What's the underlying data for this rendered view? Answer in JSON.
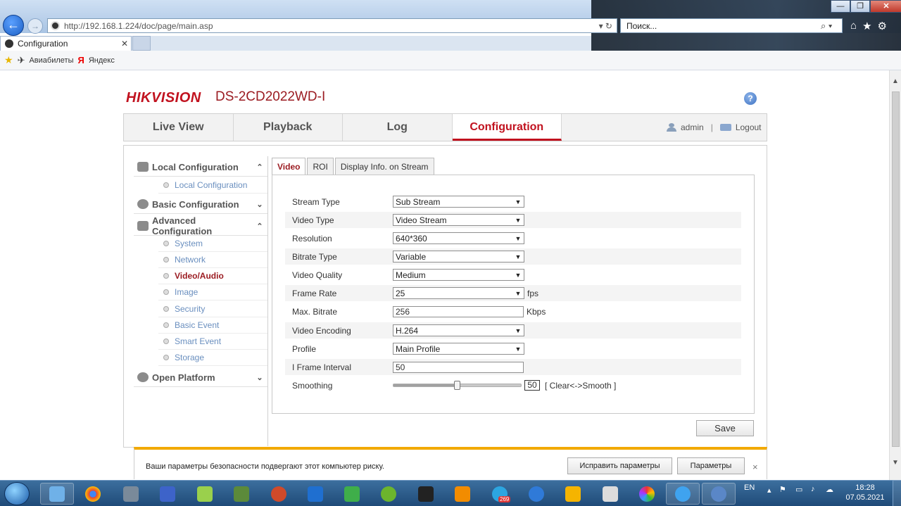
{
  "browser": {
    "url": "http://192.168.1.224/doc/page/main.asp",
    "search_placeholder": "Поиск...",
    "tab_title": "Configuration",
    "favorites": [
      "Авиабилеты",
      "Яндекс"
    ]
  },
  "header": {
    "brand": "HIKVISION",
    "model": "DS-2CD2022WD-I",
    "help": "?"
  },
  "nav": {
    "items": [
      "Live View",
      "Playback",
      "Log",
      "Configuration"
    ],
    "active": "Configuration",
    "user": "admin",
    "separator": "|",
    "logout": "Logout"
  },
  "sidebar": {
    "local_configuration": "Local Configuration",
    "local_items": [
      "Local Configuration"
    ],
    "basic_configuration": "Basic Configuration",
    "advanced_configuration": "Advanced Configuration",
    "advanced_items": [
      "System",
      "Network",
      "Video/Audio",
      "Image",
      "Security",
      "Basic Event",
      "Smart Event",
      "Storage"
    ],
    "active_item": "Video/Audio",
    "open_platform": "Open Platform"
  },
  "tabs": {
    "items": [
      "Video",
      "ROI",
      "Display Info. on Stream"
    ],
    "active": "Video"
  },
  "form": {
    "stream_type": {
      "label": "Stream Type",
      "value": "Sub Stream"
    },
    "video_type": {
      "label": "Video Type",
      "value": "Video Stream"
    },
    "resolution": {
      "label": "Resolution",
      "value": "640*360"
    },
    "bitrate_type": {
      "label": "Bitrate Type",
      "value": "Variable"
    },
    "video_quality": {
      "label": "Video Quality",
      "value": "Medium"
    },
    "frame_rate": {
      "label": "Frame Rate",
      "value": "25",
      "unit": "fps"
    },
    "max_bitrate": {
      "label": "Max. Bitrate",
      "value": "256",
      "unit": "Kbps"
    },
    "video_encoding": {
      "label": "Video Encoding",
      "value": "H.264"
    },
    "profile": {
      "label": "Profile",
      "value": "Main Profile"
    },
    "i_frame_interval": {
      "label": "I Frame Interval",
      "value": "50"
    },
    "smoothing": {
      "label": "Smoothing",
      "value": "50",
      "level": 50,
      "hint": "[ Clear<->Smooth ]"
    }
  },
  "save_label": "Save",
  "notification": {
    "text": "Ваши параметры безопасности подвергают этот компьютер риску.",
    "fix_label": "Исправить параметры",
    "settings_label": "Параметры",
    "close": "×"
  },
  "taskbar": {
    "lang": "EN",
    "time": "18:28",
    "date": "07.05.2021",
    "badge": "269"
  },
  "colors": {
    "brand_red": "#c1121f",
    "accent_red": "#9b1c22",
    "link_blue": "#6a8fbf",
    "warning_yellow": "#f2a900",
    "taskbar_blue": "#1f4a78"
  }
}
